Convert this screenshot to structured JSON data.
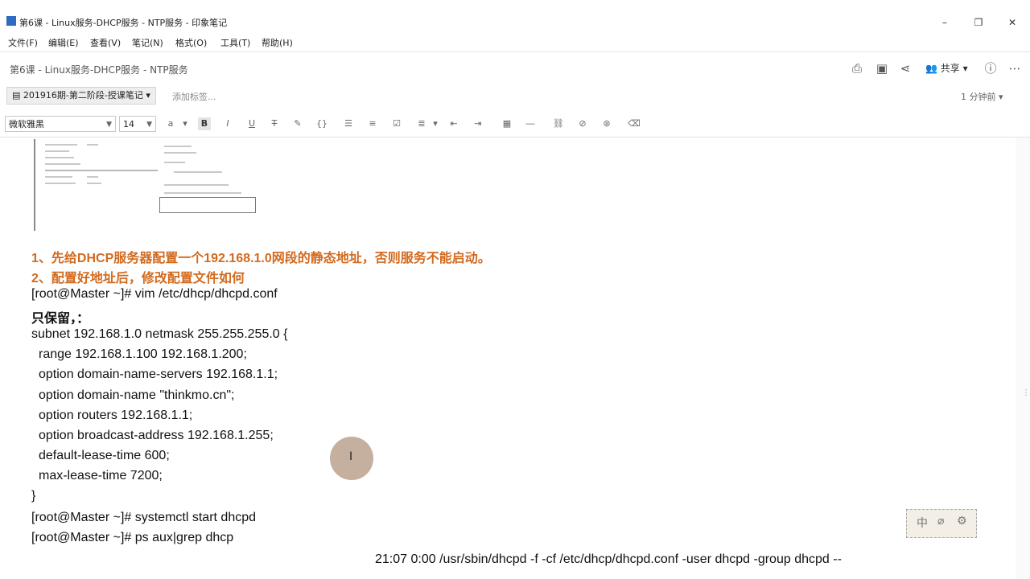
{
  "window": {
    "title": "第6课 - Linux服务-DHCP服务 - NTP服务 - 印象笔记"
  },
  "menu": [
    "文件(F)",
    "编辑(E)",
    "查看(V)",
    "笔记(N)",
    "格式(O)",
    "工具(T)",
    "帮助(H)"
  ],
  "note": {
    "title": "第6课 - Linux服务-DHCP服务 - NTP服务",
    "share_label": "共享",
    "notebook": "201916期-第二阶段-授课笔记",
    "add_tag": "添加标签...",
    "time_ago": "1 分钟前"
  },
  "format": {
    "font": "微软雅黑",
    "size": "14"
  },
  "body": {
    "step1": "1、先给DHCP服务器配置一个192.168.1.0网段的静态地址，否则服务不能启动。",
    "step2": "2、配置好地址后，修改配置文件如何",
    "lines": [
      "[root@Master ~]# vim /etc/dhcp/dhcpd.conf",
      "只保留，：",
      "subnet 192.168.1.0 netmask 255.255.255.0 {",
      "  range 192.168.1.100 192.168.1.200;",
      "  option domain-name-servers 192.168.1.1;",
      "  option domain-name \"thinkmo.cn\";",
      "  option routers 192.168.1.1;",
      "  option broadcast-address 192.168.1.255;",
      "  default-lease-time 600;",
      "  max-lease-time 7200;",
      "}",
      "[root@Master ~]# systemctl start dhcpd",
      "[root@Master ~]# ps aux|grep dhcp"
    ],
    "bottom_line": "21:07   0:00 /usr/sbin/dhcpd -f -cf /etc/dhcp/dhcpd.conf -user dhcpd -group dhcpd --"
  },
  "ime": [
    "中",
    "⌀",
    "⚙"
  ]
}
